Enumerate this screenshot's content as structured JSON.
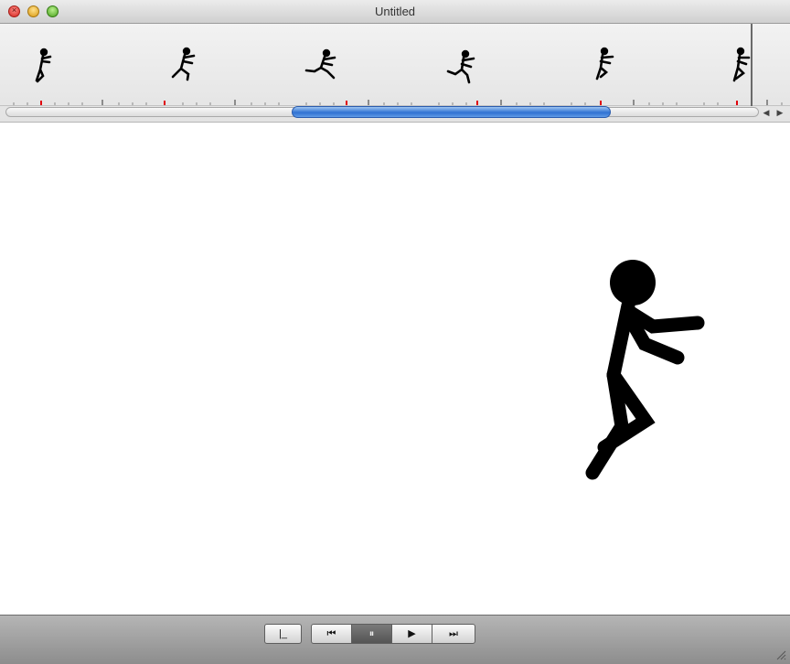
{
  "window": {
    "title": "Untitled"
  },
  "controls": {
    "close_glyph": "×",
    "first_frame_glyph": "|_",
    "prev_glyph": "⏮",
    "pause_glyph": "⏸",
    "play_glyph": "▶",
    "next_glyph": "⏭"
  },
  "scroller": {
    "left_arrow": "◀",
    "right_arrow": "▶"
  },
  "colors": {
    "accent": "#2f71d2",
    "canvas_bg": "#ffffff",
    "stick": "#000000",
    "tick_marker": "#e0000d"
  },
  "icons": [
    "close-icon",
    "minimize-icon",
    "zoom-icon",
    "first-frame-icon",
    "previous-icon",
    "pause-icon",
    "play-icon",
    "next-icon",
    "resize-grip-icon"
  ]
}
